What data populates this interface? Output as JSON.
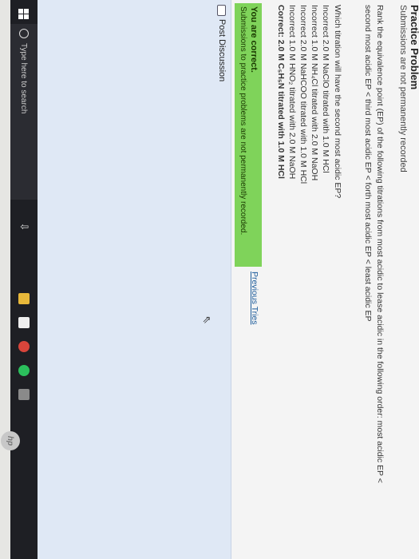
{
  "header": {
    "title": "Practice Problem",
    "subtitle": "Submissions are not permanently recorded"
  },
  "problem": {
    "text": "Rank the equivalence point (EP) of the following titrations from most acidic to lease acidic in the following order: most acidic EP < second most acidic EP < third most acidic EP < forth most acidic EP < least acidic EP",
    "question": "Which titration will have the second most acidic EP?"
  },
  "answers": [
    {
      "text": "Incorrect 2.0 M NaClO titrated with 1.0 M HCl"
    },
    {
      "text": "Incorrect 1.0 M NH₄Cl titrated with 2.0 M NaOH"
    },
    {
      "text": "Incorrect 2.0 M NaHCOO titrated with 1.0 M HCl"
    },
    {
      "text": "Incorrect 1.0 M HNO₂ titrated with 2.0 M NaOH"
    },
    {
      "text": "Correct: 2.0 M C₅H₅N titrated with 1.0 M HCl"
    }
  ],
  "feedback": {
    "title": "You are correct.",
    "message": "Submissions to practice problems are not permanently recorded.",
    "color": "#7fd35a"
  },
  "previous_tries": "Previous Tries",
  "discussion": {
    "button_label": "Post Discussion"
  },
  "taskbar": {
    "search_placeholder": "Type here to search"
  },
  "icons": [
    "windows-icon",
    "cortana-icon",
    "task-view-icon",
    "file-explorer-icon",
    "store-icon",
    "chrome-icon",
    "spotify-icon",
    "calculator-icon",
    "hp-logo"
  ]
}
